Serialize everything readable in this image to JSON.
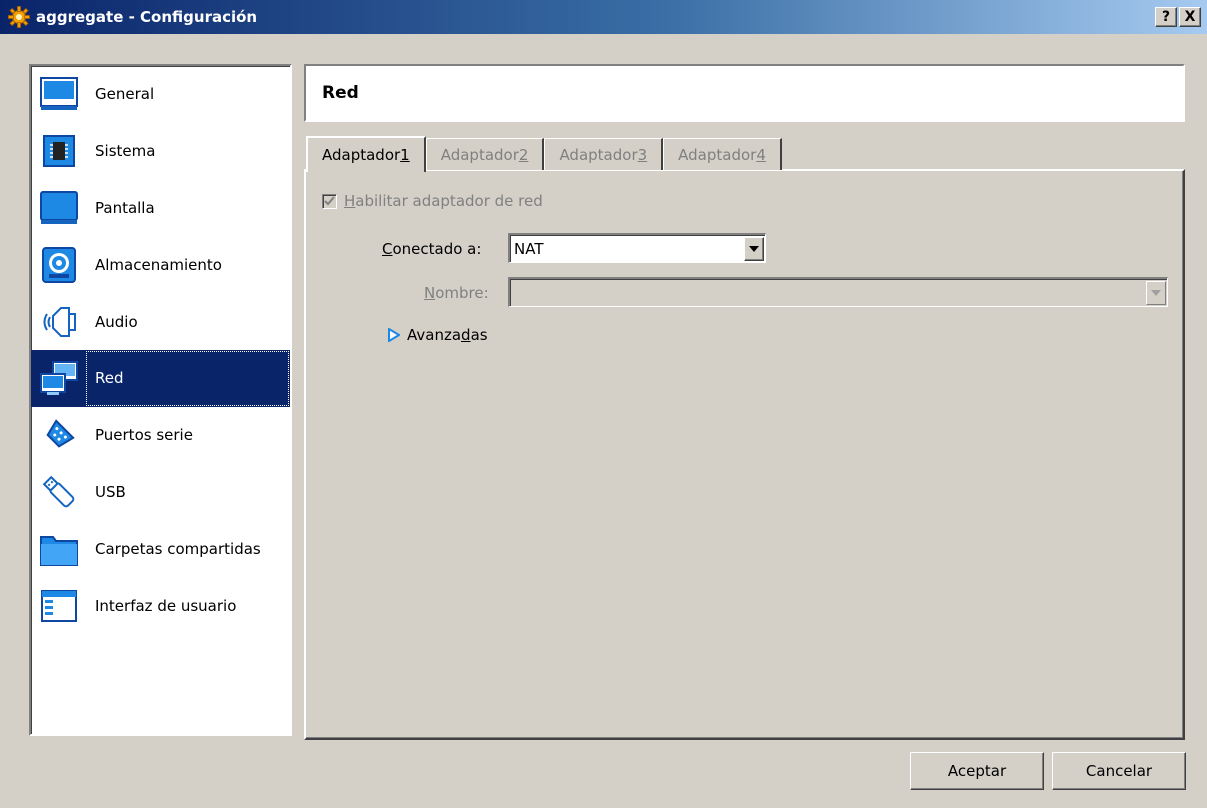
{
  "window": {
    "title": "aggregate - Configuración",
    "help_button": "?",
    "close_button": "X"
  },
  "sidebar": {
    "items": [
      {
        "label": "General",
        "icon": "monitor-general-icon"
      },
      {
        "label": "Sistema",
        "icon": "chip-icon"
      },
      {
        "label": "Pantalla",
        "icon": "display-icon"
      },
      {
        "label": "Almacenamiento",
        "icon": "disk-icon"
      },
      {
        "label": "Audio",
        "icon": "speaker-icon"
      },
      {
        "label": "Red",
        "icon": "network-icon",
        "selected": true
      },
      {
        "label": "Puertos serie",
        "icon": "serial-port-icon"
      },
      {
        "label": "USB",
        "icon": "usb-icon"
      },
      {
        "label": "Carpetas compartidas",
        "icon": "folder-icon"
      },
      {
        "label": "Interfaz de usuario",
        "icon": "window-icon"
      }
    ]
  },
  "header": {
    "title": "Red"
  },
  "tabs": [
    {
      "prefix": "Adaptador ",
      "mnemonic": "1",
      "active": true
    },
    {
      "prefix": "Adaptador ",
      "mnemonic": "2",
      "active": false
    },
    {
      "prefix": "Adaptador ",
      "mnemonic": "3",
      "active": false
    },
    {
      "prefix": "Adaptador ",
      "mnemonic": "4",
      "active": false
    }
  ],
  "adapter": {
    "enable_mnemonic": "H",
    "enable_rest": "abilitar adaptador de red",
    "enable_checked": true,
    "attached_mnemonic": "C",
    "attached_rest": "onectado a:",
    "attached_value": "NAT",
    "name_mnemonic": "N",
    "name_rest": "ombre:",
    "name_value": "",
    "advanced_pre": "Avanza",
    "advanced_mnemonic": "d",
    "advanced_post": "as"
  },
  "buttons": {
    "ok": "Aceptar",
    "cancel": "Cancelar"
  },
  "colors": {
    "titlebar_start": "#0a246a",
    "titlebar_end": "#a6caf0",
    "selection": "#0a246a",
    "face": "#d4d0c8",
    "icon_blue": "#1e88e5"
  }
}
